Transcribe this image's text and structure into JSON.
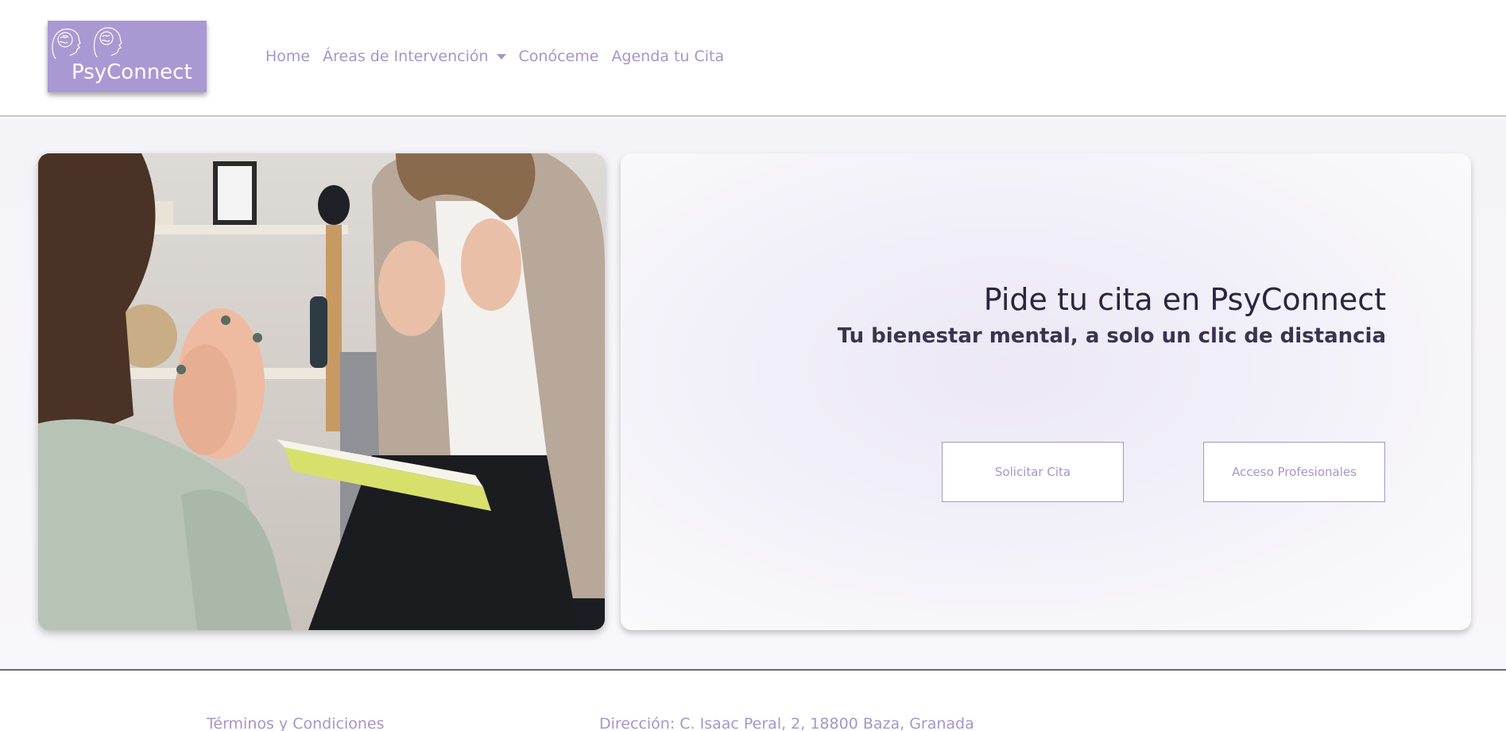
{
  "brand": {
    "name": "PsyConnect",
    "logo_bg": "#a999d3"
  },
  "nav": {
    "items": [
      {
        "label": "Home"
      },
      {
        "label": "Áreas de Intervención",
        "has_dropdown": true
      },
      {
        "label": "Conóceme"
      },
      {
        "label": "Agenda tu Cita"
      }
    ],
    "color": "#a596c9"
  },
  "hero": {
    "title": "Pide tu cita en PsyConnect",
    "subtitle": "Tu bienestar mental, a solo un clic de distancia",
    "buttons": {
      "request": "Solicitar Cita",
      "professionals": "Acceso Profesionales"
    }
  },
  "footer": {
    "terms": "Términos y Condiciones",
    "address": "Dirección: C. Isaac Peral, 2, 18800 Baza, Granada"
  },
  "colors": {
    "accent": "#a596c9",
    "heading": "#2b2540"
  }
}
